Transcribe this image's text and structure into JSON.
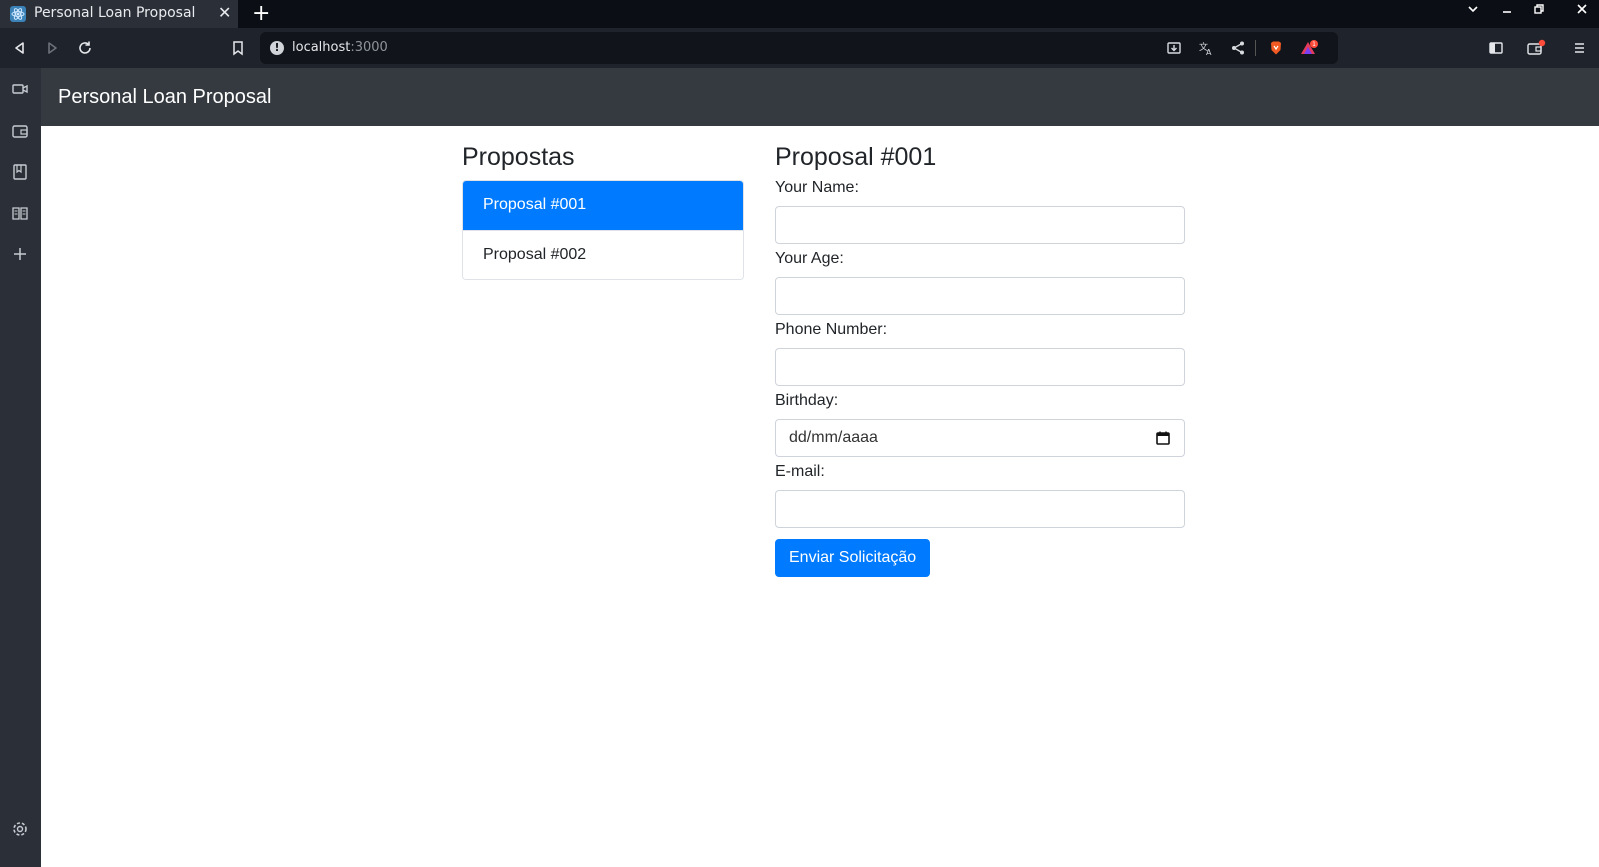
{
  "browser": {
    "tab_title": "Personal Loan Proposal",
    "tab_close": "✕",
    "new_tab": "+",
    "url_host": "localhost",
    "url_port": ":3000",
    "notification_count": "1"
  },
  "app": {
    "brand": "Personal Loan Proposal"
  },
  "sidebar": {
    "heading": "Propostas",
    "items": [
      {
        "label": "Proposal #001",
        "active": true
      },
      {
        "label": "Proposal #002",
        "active": false
      }
    ]
  },
  "form": {
    "heading": "Proposal #001",
    "fields": {
      "name": {
        "label": "Your Name:",
        "value": ""
      },
      "age": {
        "label": "Your Age:",
        "value": ""
      },
      "phone": {
        "label": "Phone Number:",
        "value": ""
      },
      "birthday": {
        "label": "Birthday:",
        "placeholder": "dd/mm/aaaa"
      },
      "email": {
        "label": "E-mail:",
        "value": ""
      }
    },
    "submit_label": "Enviar Solicitação"
  },
  "colors": {
    "primary": "#007bff",
    "navbar": "#343a40"
  }
}
